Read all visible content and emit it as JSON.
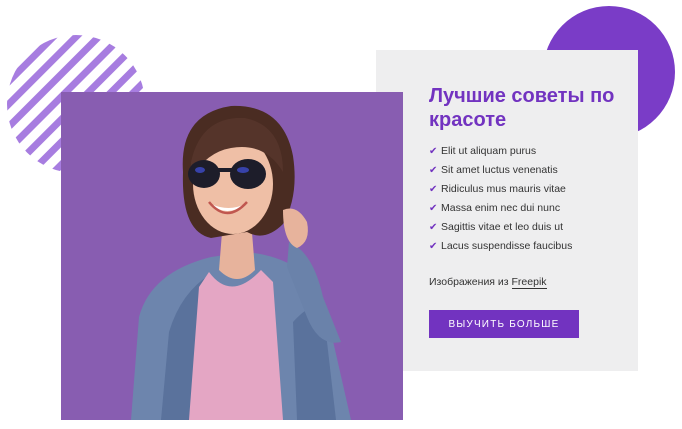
{
  "section": {
    "title": "Лучшие советы по красоте",
    "features": [
      "Elit ut aliquam purus",
      "Sit amet luctus venenatis",
      "Ridiculus mus mauris vitae",
      "Massa enim nec dui nunc",
      "Sagittis vitae et leo duis ut",
      "Lacus suspendisse faucibus"
    ],
    "check_icon": "check-icon",
    "credit_prefix": "Изображения из",
    "credit_link": "Freepik",
    "button_label": "ВЫУЧИТЬ БОЛЬШЕ"
  },
  "colors": {
    "accent": "#7233c0",
    "circle": "#7a3cc7",
    "stripes": "#a77de0",
    "card_bg": "#eeeeef",
    "photo_bg": "#8e62b5",
    "text": "#333333"
  }
}
